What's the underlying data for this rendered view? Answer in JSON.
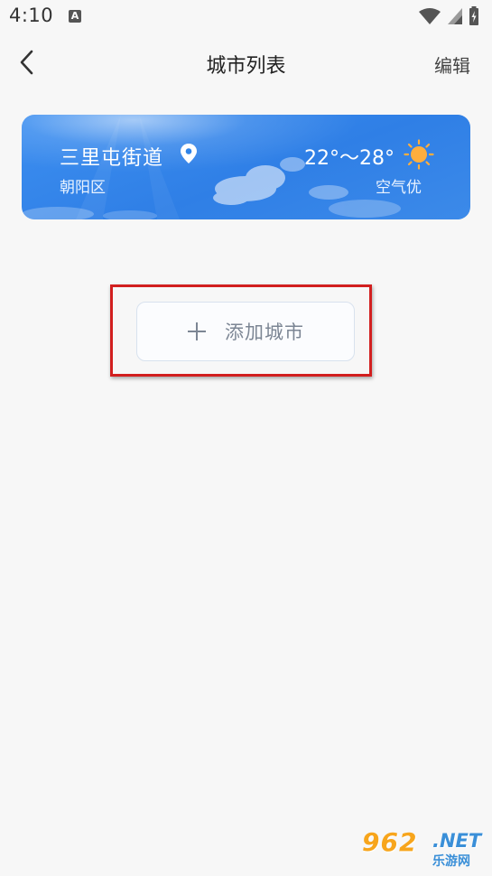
{
  "status_bar": {
    "time": "4:10",
    "notification_icon_letter": "A"
  },
  "header": {
    "title": "城市列表",
    "edit_label": "编辑"
  },
  "city_card": {
    "city": "三里屯街道",
    "district": "朝阳区",
    "temperature": "22°～28°",
    "air_quality": "空气优",
    "weather_icon": "sun-icon"
  },
  "add_city": {
    "label": "添加城市"
  },
  "watermark": {
    "main": "962",
    "suffix": ".NET",
    "sub": "乐游网"
  },
  "colors": {
    "card_blue": "#3084e8",
    "highlight_red": "#d21f1f",
    "sun_orange": "#ffae3d"
  }
}
